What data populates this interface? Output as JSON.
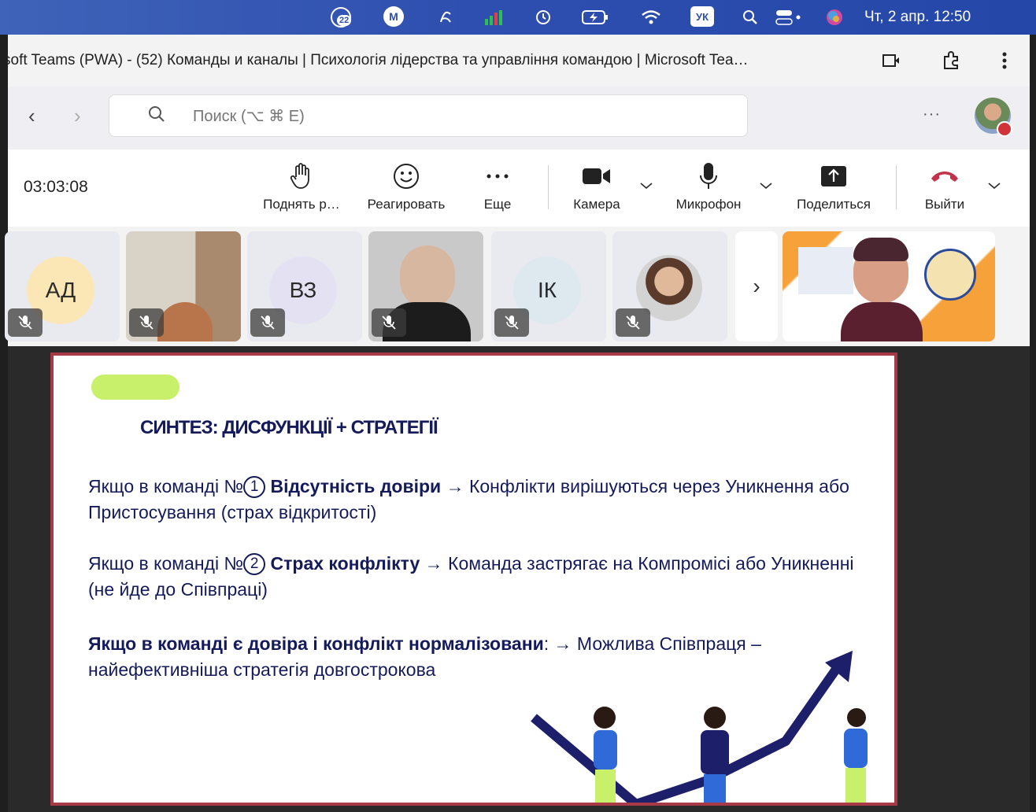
{
  "menubar": {
    "notification_count": "22",
    "m_label": "M",
    "keyboard_layout": "УК",
    "clock": "Чт, 2 апр.  12:50"
  },
  "window": {
    "title": "soft Teams (PWA) - (52) Команды и каналы | Психологія лідерства та управління командою | Microsoft Tea…"
  },
  "nav": {
    "search_placeholder": "Поиск (⌥ ⌘ E)",
    "more": "···"
  },
  "call": {
    "timer": "03:03:08",
    "controls": {
      "raise_hand": "Поднять р…",
      "react": "Реагировать",
      "more": "Еще",
      "camera": "Камера",
      "mic": "Микрофон",
      "share": "Поделиться",
      "leave": "Выйти"
    }
  },
  "participants": {
    "initials": [
      "АД",
      "ВЗ",
      "ІК"
    ],
    "next": "›"
  },
  "slide": {
    "title": "СИНТЕЗ: ДИСФУНКЦІЇ + СТРАТЕГІЇ",
    "p1_prefix": "Якщо в команді №",
    "p1_num": "1",
    "p1_bold": "Відсутність довіри",
    "p1_rest": " → Конфлікти вирішуються через Уникнення або Пристосування (страх відкритості)",
    "p2_prefix": "Якщо в команді №",
    "p2_num": "2",
    "p2_bold": "Страх конфлікту",
    "p2_rest": " → Команда застрягає на Компромісі або Уникненні (не йде до Співпраці)",
    "p3_bold": "Якщо в команді є довіра і конфлікт нормалізовани",
    "p3_rest": ": →  Можлива Співпраця – найефективніша стратегія довгострокова"
  },
  "colors": {
    "slide_text": "#141a5a",
    "slide_border": "#a83a47",
    "accent_pill": "#c8f06a",
    "leave_red": "#c4314b"
  }
}
